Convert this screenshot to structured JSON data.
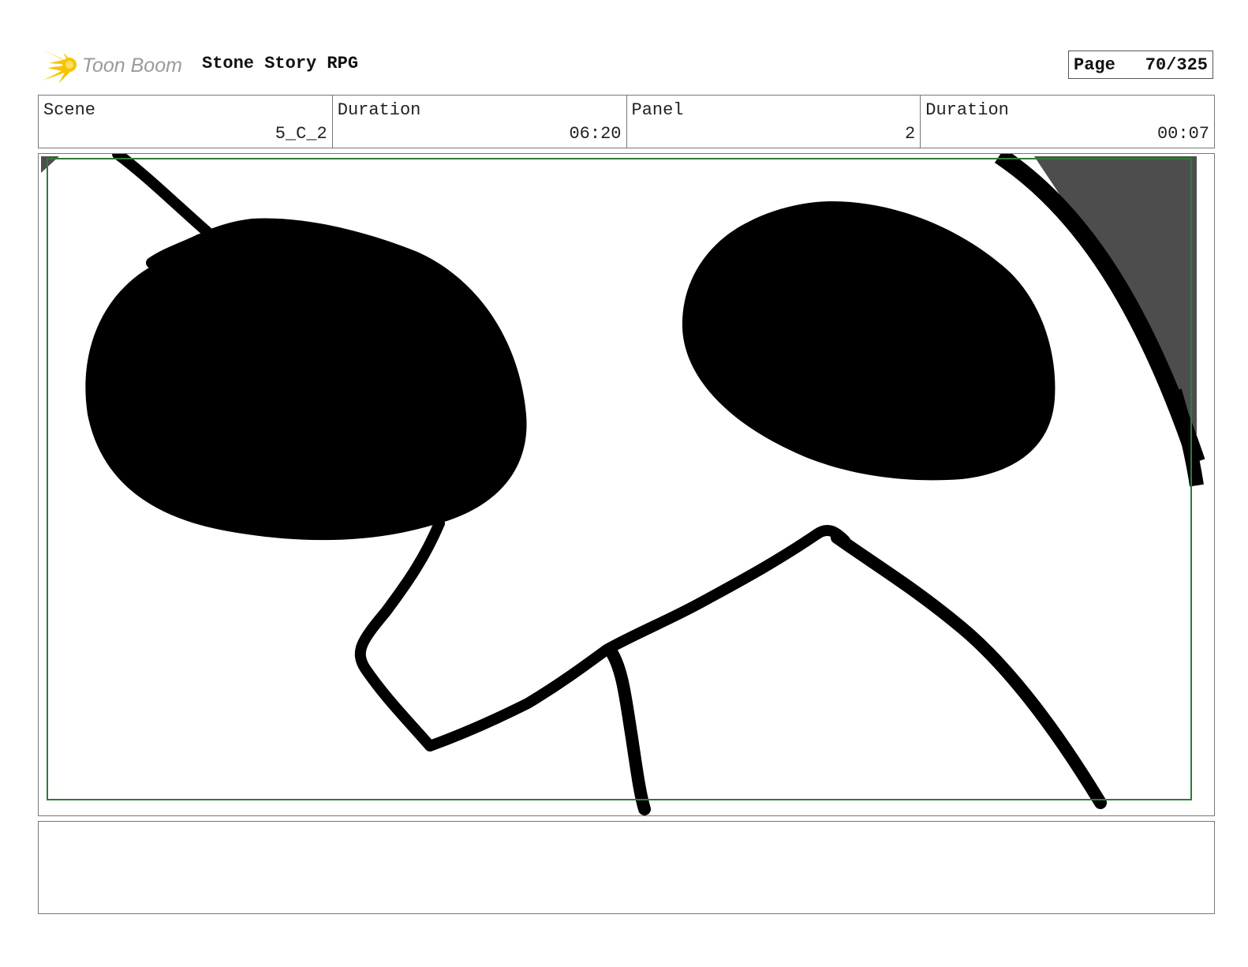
{
  "header": {
    "logo_text": "Toon Boom",
    "project_title": "Stone Story RPG",
    "page_label": "Page",
    "page_number": "70/325"
  },
  "info": {
    "scene_label": "Scene",
    "scene_value": "5_C_2",
    "scene_duration_label": "Duration",
    "scene_duration_value": "06:20",
    "panel_label": "Panel",
    "panel_value": "2",
    "panel_duration_label": "Duration",
    "panel_duration_value": "00:07"
  },
  "notes": {
    "text": ""
  },
  "colors": {
    "safe_frame": "#2e7d32",
    "ink": "#000000",
    "shade": "#4d4d4d",
    "logo_yellow": "#f5c400",
    "logo_gray": "#9a9a9a"
  }
}
